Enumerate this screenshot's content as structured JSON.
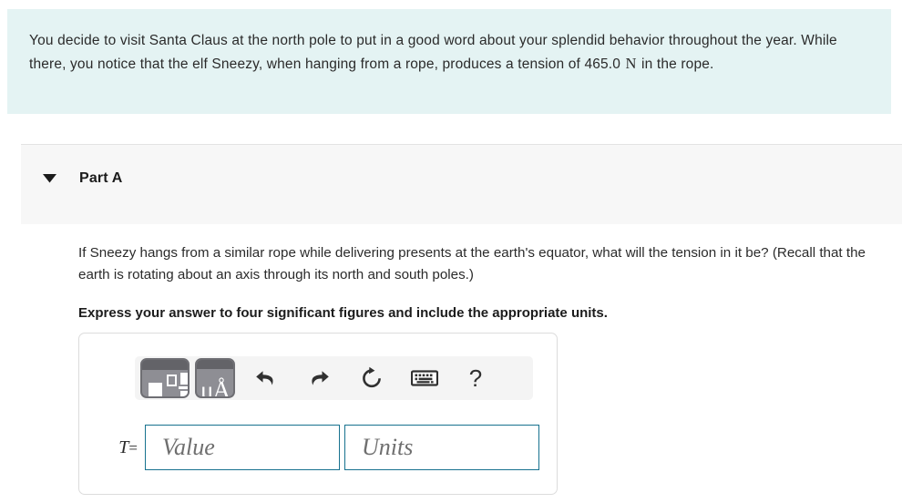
{
  "problem": {
    "text_before_unit": "You decide to visit Santa Claus at the north pole to put in a good word about your splendid behavior throughout the year. While there, you notice that the elf Sneezy, when hanging from a rope, produces a tension of 465.0 ",
    "unit": "N",
    "text_after_unit": " in the rope.",
    "background_color": "#e4f3f3"
  },
  "part": {
    "title": "Part A",
    "caret_icon": "caret-down-icon",
    "expanded": true,
    "question": "If Sneezy hangs from a similar rope while delivering presents at the earth's equator, what will the tension in it be? (Recall that the earth is rotating about an axis through its north and south poles.)",
    "instruction": "Express your answer to four significant figures and include the appropriate units."
  },
  "answer": {
    "variable": "T",
    "equals": "=",
    "value_placeholder": "Value",
    "units_placeholder": "Units",
    "value": "",
    "units": "",
    "border_color": "#17728f",
    "toolbar": {
      "template_button": "math-template-palette",
      "units_button_label": "μÅ",
      "undo_label": "undo-icon",
      "redo_label": "redo-icon",
      "reset_label": "reset-icon",
      "keyboard_label": "keyboard-icon",
      "help_label": "?"
    }
  }
}
